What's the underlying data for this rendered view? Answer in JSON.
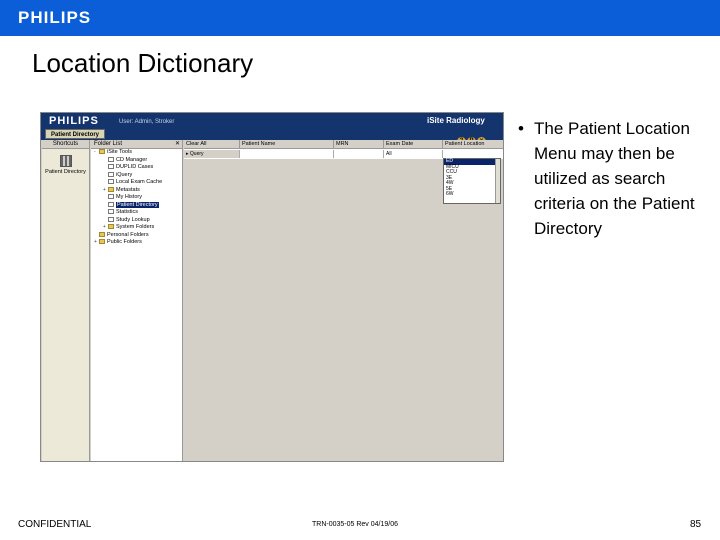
{
  "slide": {
    "brand": "PHILIPS",
    "title": "Location Dictionary",
    "bullet": "The Patient Location Menu may then be utilized as search criteria on the Patient Directory",
    "footer_left": "CONFIDENTIAL",
    "footer_center": "TRN-0035-05 Rev 04/19/06",
    "page_number": "85",
    "colors": {
      "header_blue": "#0b5ed7",
      "app_header": "#14346e",
      "selection": "#0a246a"
    }
  },
  "app": {
    "logo": "PHILIPS",
    "user": "User: Admin, Stroker",
    "product": "iSite Radiology",
    "active_tab": "Patient Directory",
    "header_icons": [
      "help-icon",
      "preferences-icon",
      "logout-icon"
    ],
    "shortcuts": {
      "header": "Shortcuts",
      "item_label": "Patient Directory",
      "item_icon": "directory-icon"
    },
    "folder_list": {
      "header": "Folder List",
      "items": [
        {
          "label": "iSite Tools",
          "level": 0,
          "icon": "folder",
          "expander": "-"
        },
        {
          "label": "CD Manager",
          "level": 1,
          "icon": "doc",
          "expander": ""
        },
        {
          "label": "DUPLID Cases",
          "level": 1,
          "icon": "doc",
          "expander": ""
        },
        {
          "label": "iQuery",
          "level": 1,
          "icon": "doc",
          "expander": ""
        },
        {
          "label": "Local Exam Cache",
          "level": 1,
          "icon": "doc",
          "expander": ""
        },
        {
          "label": "Metastats",
          "level": 1,
          "icon": "folder",
          "expander": "+"
        },
        {
          "label": "My History",
          "level": 1,
          "icon": "doc",
          "expander": ""
        },
        {
          "label": "Patient Directory",
          "level": 1,
          "icon": "doc",
          "expander": "",
          "selected": true
        },
        {
          "label": "Statistics",
          "level": 1,
          "icon": "doc",
          "expander": ""
        },
        {
          "label": "Study Lookup",
          "level": 1,
          "icon": "doc",
          "expander": ""
        },
        {
          "label": "System Folders",
          "level": 1,
          "icon": "folder",
          "expander": "+"
        },
        {
          "label": "Personal Folders",
          "level": 0,
          "icon": "folder",
          "expander": ""
        },
        {
          "label": "Public Folders",
          "level": 0,
          "icon": "folder",
          "expander": "+"
        }
      ]
    },
    "grid": {
      "columns": [
        "Clear All",
        "Patient Name",
        "MRN",
        "Exam Date",
        "Patient Location"
      ],
      "filter": {
        "query_button": "Query",
        "exam_date_value": "All"
      },
      "location_options": [
        "ED",
        "MICU",
        "CCU",
        "3E",
        "4W",
        "5E",
        "6W"
      ],
      "selected_location": "ED"
    }
  }
}
